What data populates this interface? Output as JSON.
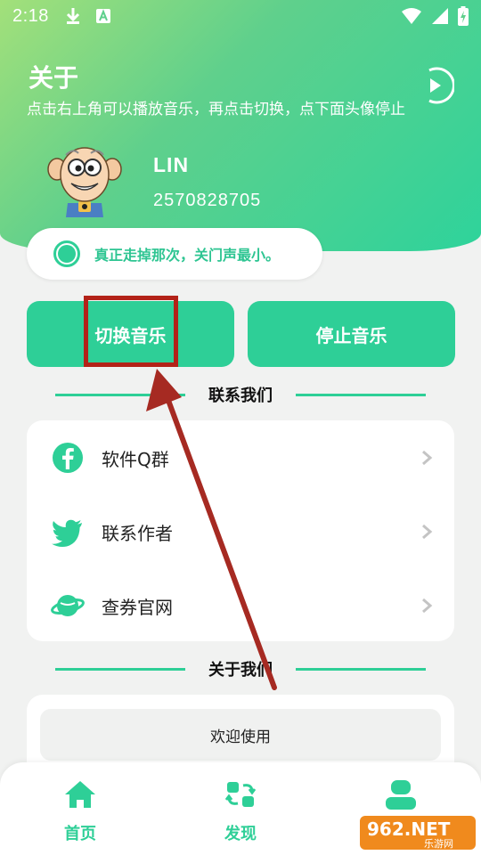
{
  "status_bar": {
    "time": "2:18"
  },
  "header": {
    "title": "关于",
    "subtitle": "点击右上角可以播放音乐，再点击切换，点下面头像停止"
  },
  "profile": {
    "name": "LIN",
    "id": "2570828705"
  },
  "quote": {
    "text": "真正走掉那次，关门声最小。"
  },
  "buttons": {
    "switch_music": "切换音乐",
    "stop_music": "停止音乐"
  },
  "sections": {
    "contact": "联系我们",
    "about": "关于我们"
  },
  "contact_items": [
    {
      "label": "软件Q群",
      "icon": "facebook-icon"
    },
    {
      "label": "联系作者",
      "icon": "twitter-icon"
    },
    {
      "label": "查券官网",
      "icon": "planet-icon"
    }
  ],
  "about": {
    "welcome": "欢迎使用"
  },
  "nav": {
    "items": [
      {
        "label": "首页"
      },
      {
        "label": "发现"
      }
    ]
  },
  "watermark": {
    "text": "962.NET",
    "subtext": "乐游网"
  },
  "colors": {
    "accent": "#2ecf97",
    "highlight": "#b32218",
    "arrow": "#a62a22"
  }
}
